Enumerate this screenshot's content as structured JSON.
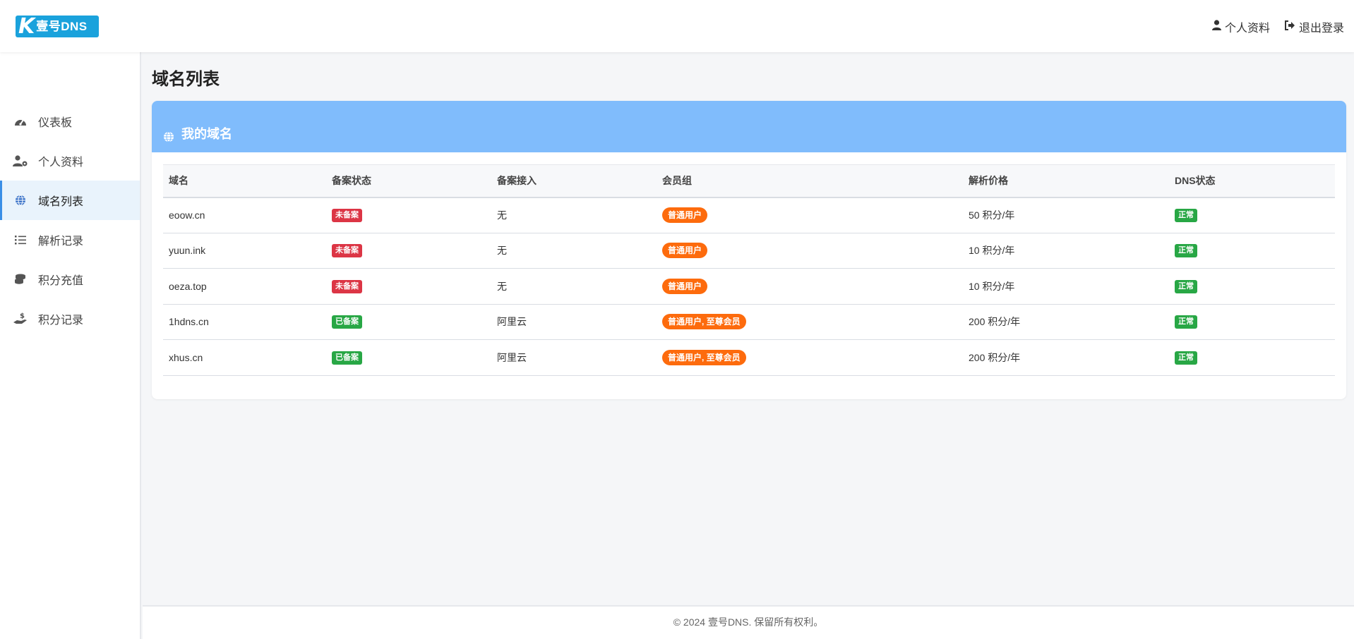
{
  "header": {
    "logo_k": "K",
    "logo_text": "壹号DNS",
    "profile_label": "个人资料",
    "logout_label": "退出登录"
  },
  "sidebar": {
    "items": [
      {
        "label": "仪表板",
        "icon": "gauge-icon"
      },
      {
        "label": "个人资料",
        "icon": "user-gear-icon"
      },
      {
        "label": "域名列表",
        "icon": "globe-icon",
        "active": true
      },
      {
        "label": "解析记录",
        "icon": "list-icon"
      },
      {
        "label": "积分充值",
        "icon": "coins-icon"
      },
      {
        "label": "积分记录",
        "icon": "hand-dollar-icon"
      }
    ]
  },
  "main": {
    "page_title": "域名列表",
    "card_title": "我的域名",
    "table": {
      "headers": [
        "域名",
        "备案状态",
        "备案接入",
        "会员组",
        "解析价格",
        "DNS状态"
      ],
      "rows": [
        {
          "domain": "eoow.cn",
          "icp": "未备案",
          "icp_status": "none",
          "access": "无",
          "group": "普通用户",
          "price": "50 积分/年",
          "dns": "正常"
        },
        {
          "domain": "yuun.ink",
          "icp": "未备案",
          "icp_status": "none",
          "access": "无",
          "group": "普通用户",
          "price": "10 积分/年",
          "dns": "正常"
        },
        {
          "domain": "oeza.top",
          "icp": "未备案",
          "icp_status": "none",
          "access": "无",
          "group": "普通用户",
          "price": "10 积分/年",
          "dns": "正常"
        },
        {
          "domain": "1hdns.cn",
          "icp": "已备案",
          "icp_status": "filed",
          "access": "阿里云",
          "group": "普通用户, 至尊会员",
          "price": "200 积分/年",
          "dns": "正常"
        },
        {
          "domain": "xhus.cn",
          "icp": "已备案",
          "icp_status": "filed",
          "access": "阿里云",
          "group": "普通用户, 至尊会员",
          "price": "200 积分/年",
          "dns": "正常"
        }
      ]
    }
  },
  "footer": {
    "text": "© 2024 壹号DNS. 保留所有权利。"
  },
  "colors": {
    "card_header": "#80bcfc",
    "badge_red": "#dc3545",
    "badge_green": "#28a745",
    "pill_orange": "#fd6b0d",
    "active_accent": "#3a8ee6"
  }
}
